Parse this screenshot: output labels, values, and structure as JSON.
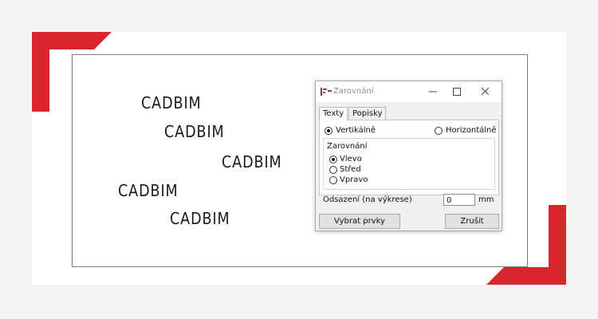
{
  "colors": {
    "accent_red": "#d7262c",
    "frame_bg": "#ffffff",
    "outer_bg": "#f3f3f3"
  },
  "canvas": {
    "texts": [
      "CADBIM",
      "CADBIM",
      "CADBIM",
      "CADBIM",
      "CADBIM"
    ]
  },
  "dialog": {
    "title": "Zarovnání",
    "window_controls": [
      "minimize-icon",
      "maximize-icon",
      "close-icon"
    ],
    "tabs": [
      {
        "label": "Texty",
        "active": true
      },
      {
        "label": "Popisky",
        "active": false
      }
    ],
    "orientation": {
      "vertical": {
        "label": "Vertikálně",
        "checked": true
      },
      "horizontal": {
        "label": "Horizontálně",
        "checked": false
      }
    },
    "alignment": {
      "group_label": "Zarovnání",
      "options": [
        {
          "label": "Vlevo",
          "checked": true
        },
        {
          "label": "Střed",
          "checked": false
        },
        {
          "label": "Vpravo",
          "checked": false
        }
      ]
    },
    "offset": {
      "label": "Odsazení (na výkrese)",
      "value": "0",
      "unit": "mm"
    },
    "buttons": {
      "select": "Vybrat prvky",
      "cancel": "Zrušit"
    }
  }
}
